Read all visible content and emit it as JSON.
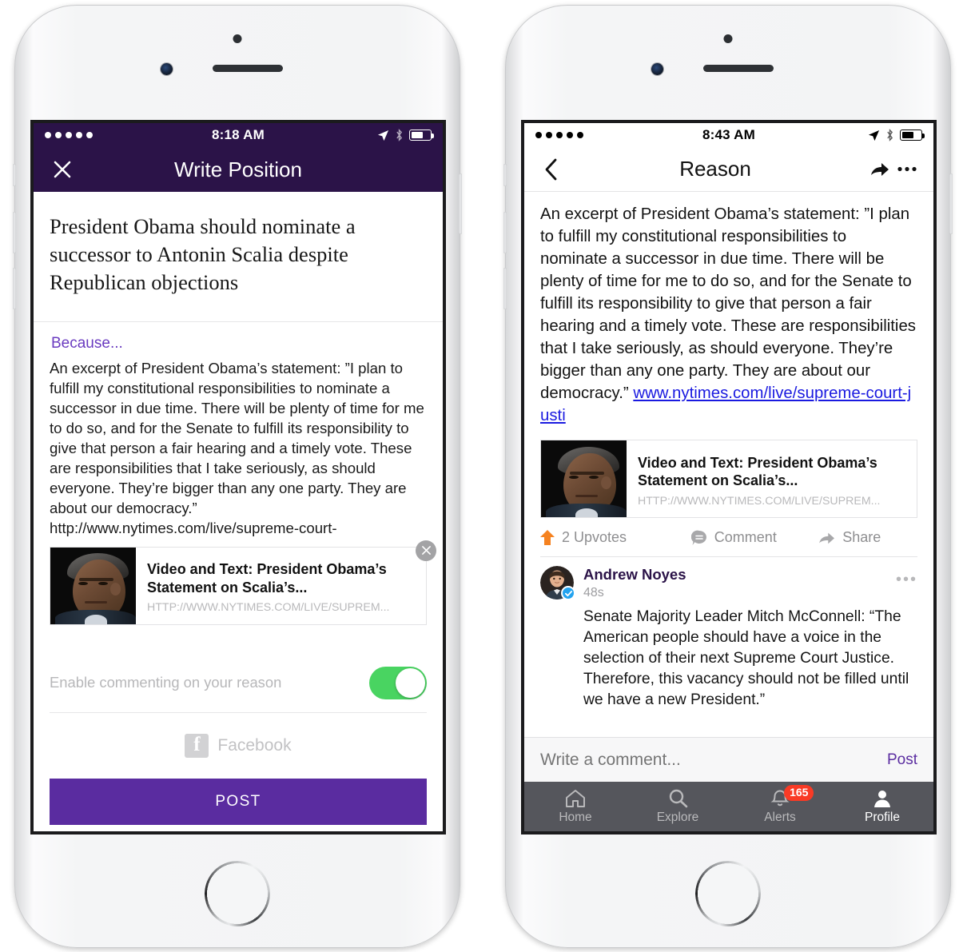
{
  "colors": {
    "nav_purple": "#2b1348",
    "accent_purple": "#5a2ca0",
    "because_purple": "#6a3bc0",
    "toggle_green": "#49d461",
    "link_blue": "#1a1ae0",
    "badge_red": "#f93a25",
    "upvote_orange": "#f58220",
    "verified_blue": "#23a3ef",
    "tabbar_gray": "#55565c"
  },
  "left_phone": {
    "status_bar": {
      "signal_dots": 5,
      "time": "8:18 AM",
      "location_icon": "location-arrow-icon",
      "bluetooth_icon": "bluetooth-icon",
      "battery_icon": "battery-icon",
      "battery_level_pct": 62,
      "theme": "dark"
    },
    "nav": {
      "close_icon": "close-icon",
      "title": "Write Position"
    },
    "position_title": "President Obama should nominate a successor to Antonin Scalia despite Republican objections",
    "because_label": "Because...",
    "reason_text": "An excerpt of President Obama’s statement:  ”I plan to fulfill my constitutional responsibilities to nominate a successor in due time. There will be plenty of time for me to do so, and for the Senate to fulfill its responsibility to give that person a fair hearing and a timely vote. These are responsibilities that I take seriously, as should everyone. They’re bigger than any one party. They are about our democracy.” http://www.nytimes.com/live/supreme-court-",
    "link_card": {
      "thumb_alt": "obama-portrait-thumbnail",
      "title": "Video and Text: President Obama’s Statement on Scalia’s...",
      "url": "HTTP://WWW.NYTIMES.COM/LIVE/SUPREM...",
      "close_icon": "close-icon"
    },
    "toggle_row": {
      "label": "Enable commenting on your reason",
      "state": "on"
    },
    "facebook_row": {
      "icon": "facebook-icon",
      "label": "Facebook"
    },
    "post_button": "POST"
  },
  "right_phone": {
    "status_bar": {
      "signal_dots": 5,
      "time": "8:43 AM",
      "location_icon": "location-arrow-icon",
      "bluetooth_icon": "bluetooth-icon",
      "battery_icon": "battery-icon",
      "battery_level_pct": 60,
      "theme": "light"
    },
    "nav": {
      "back_icon": "chevron-left-icon",
      "title": "Reason",
      "share_icon": "share-icon",
      "more_icon": "more-horizontal-icon"
    },
    "reason_text": "An excerpt of President Obama’s statement:  ”I plan to fulfill my constitutional responsibilities to nominate a successor in due time. There will be plenty of time for me to do so, and for the Senate to fulfill its responsibility to give that person a fair hearing and a timely vote. These are responsibilities that I take seriously, as should everyone. They’re bigger than any one party. They are about our democracy.” ",
    "reason_link": "www.nytimes.com/live/supreme-court-justi",
    "link_card": {
      "thumb_alt": "obama-portrait-thumbnail",
      "title": "Video and Text: President Obama’s Statement on Scalia’s...",
      "url": "HTTP://WWW.NYTIMES.COM/LIVE/SUPREM..."
    },
    "actions": [
      {
        "icon": "upvote-icon",
        "label": "2 Upvotes"
      },
      {
        "icon": "comment-icon",
        "label": "Comment"
      },
      {
        "icon": "share-icon",
        "label": "Share"
      }
    ],
    "comment": {
      "avatar_alt": "andrew-noyes-avatar",
      "verified": true,
      "author": "Andrew Noyes",
      "time": "48s",
      "more_icon": "more-horizontal-icon",
      "text": "Senate Majority Leader Mitch McConnell: “The American people should have a voice in the selection of their next Supreme Court Justice. Therefore, this vacancy should not be filled until we have a new President.”"
    },
    "comment_input": {
      "placeholder": "Write a comment...",
      "value": "",
      "post_label": "Post"
    },
    "tabbar": [
      {
        "icon": "home-icon",
        "label": "Home",
        "active": false,
        "badge": ""
      },
      {
        "icon": "search-icon",
        "label": "Explore",
        "active": false,
        "badge": ""
      },
      {
        "icon": "bell-icon",
        "label": "Alerts",
        "active": false,
        "badge": "165"
      },
      {
        "icon": "person-icon",
        "label": "Profile",
        "active": true,
        "badge": ""
      }
    ]
  }
}
